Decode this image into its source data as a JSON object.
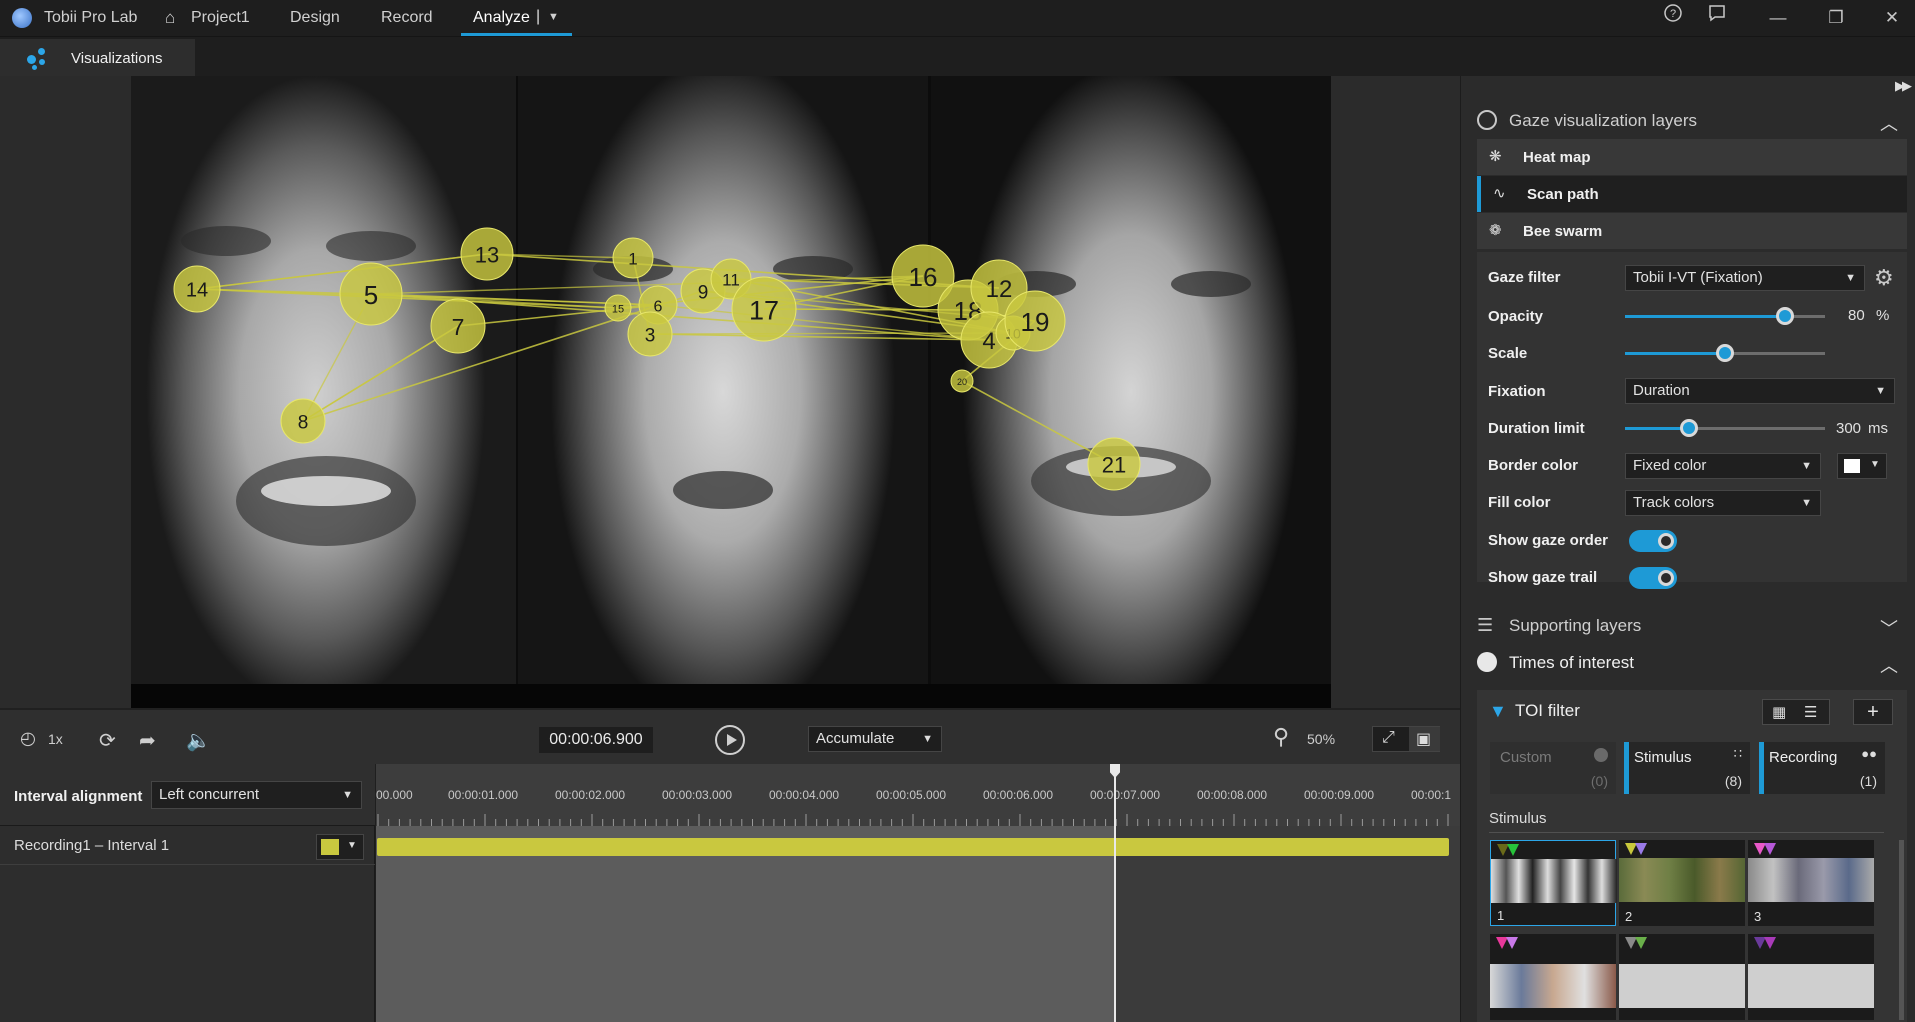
{
  "app": {
    "name": "Tobii Pro Lab",
    "project": "Project1",
    "tabs": [
      "Design",
      "Record",
      "Analyze"
    ],
    "active_tab": "Analyze"
  },
  "secondary_tab": "Visualizations",
  "colors": {
    "accent": "#1e9ad6",
    "fixation_fill": "#c9c83f",
    "panel": "#2b2b2b"
  },
  "gaze_points": [
    {
      "label": "14"
    },
    {
      "label": "5"
    },
    {
      "label": "13"
    },
    {
      "label": "7"
    },
    {
      "label": "8"
    },
    {
      "label": "1"
    },
    {
      "label": "15"
    },
    {
      "label": "6"
    },
    {
      "label": "3"
    },
    {
      "label": "9"
    },
    {
      "label": "11"
    },
    {
      "label": "17"
    },
    {
      "label": "16"
    },
    {
      "label": "18"
    },
    {
      "label": "12"
    },
    {
      "label": "4"
    },
    {
      "label": "10"
    },
    {
      "label": "19"
    },
    {
      "label": "20"
    },
    {
      "label": "21"
    }
  ],
  "right_panel": {
    "gaze_layers": {
      "title": "Gaze visualization layers",
      "items": [
        "Heat map",
        "Scan path",
        "Bee swarm"
      ],
      "active": "Scan path"
    },
    "props": {
      "gaze_filter_label": "Gaze filter",
      "gaze_filter_value": "Tobii I-VT (Fixation)",
      "opacity_label": "Opacity",
      "opacity_value": "80",
      "opacity_unit": "%",
      "opacity_fraction": 0.8,
      "scale_label": "Scale",
      "scale_fraction": 0.5,
      "fixation_label": "Fixation",
      "fixation_value": "Duration",
      "duration_limit_label": "Duration limit",
      "duration_limit_value": "300",
      "duration_limit_unit": "ms",
      "duration_limit_fraction": 0.32,
      "border_color_label": "Border color",
      "border_color_value": "Fixed color",
      "fill_color_label": "Fill color",
      "fill_color_value": "Track colors",
      "show_gaze_order_label": "Show gaze order",
      "show_gaze_order": true,
      "show_gaze_trail_label": "Show gaze trail",
      "show_gaze_trail": true
    },
    "supporting_layers": "Supporting layers",
    "times_of_interest": "Times of interest",
    "toi_filter": "TOI filter",
    "toi_cards": [
      {
        "title": "Custom",
        "count": "(0)"
      },
      {
        "title": "Stimulus",
        "count": "(8)"
      },
      {
        "title": "Recording",
        "count": "(1)"
      }
    ],
    "stimulus_header": "Stimulus",
    "thumbnails": [
      "1",
      "2",
      "3"
    ]
  },
  "transport": {
    "speed": "1x",
    "time": "00:00:06.900",
    "mode": "Accumulate",
    "zoom": "50%"
  },
  "timeline": {
    "interval_alignment_label": "Interval alignment",
    "interval_alignment_value": "Left concurrent",
    "recording_label": "Recording1 – Interval 1",
    "ticks": [
      "00.000",
      "00:00:01.000",
      "00:00:02.000",
      "00:00:03.000",
      "00:00:04.000",
      "00:00:05.000",
      "00:00:06.000",
      "00:00:07.000",
      "00:00:08.000",
      "00:00:09.000",
      "00:00:1"
    ]
  }
}
